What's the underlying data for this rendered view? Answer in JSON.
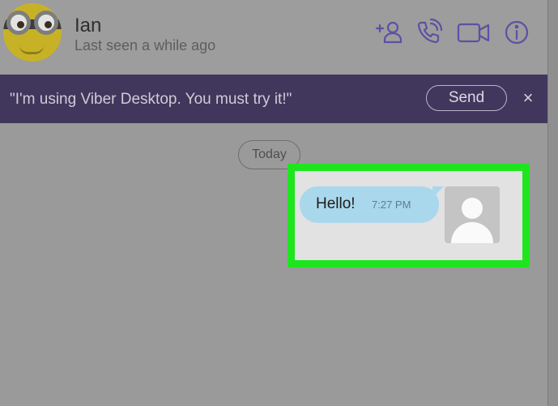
{
  "contact": {
    "name": "Ian",
    "status": "Last seen a while ago"
  },
  "header_icons": [
    "add-participant-icon",
    "phone-icon",
    "video-icon",
    "info-icon"
  ],
  "banner": {
    "message": "\"I'm using Viber Desktop. You must try it!\"",
    "send_label": "Send",
    "close_symbol": "×"
  },
  "chat": {
    "date_label": "Today",
    "messages": [
      {
        "text": "Hello!",
        "time": "7:27 PM"
      }
    ]
  },
  "colors": {
    "banner_bg": "#41375c",
    "icon_purple": "#5f4fa3",
    "bubble": "#a9d8ec",
    "highlight": "#1fe51f"
  }
}
